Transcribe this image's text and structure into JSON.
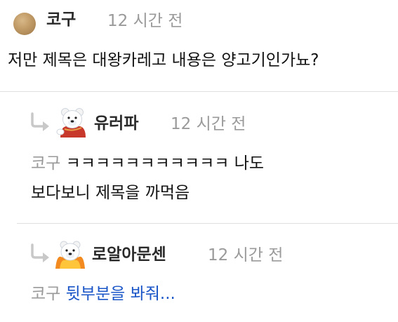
{
  "comment": {
    "author": "코구",
    "time": "12 시간 전",
    "text": "저만 제목은 대왕카레고 내용은 양고기인가뇨?"
  },
  "replies": [
    {
      "author": "유러파",
      "time": "12 시간 전",
      "mention": "코구",
      "line1": "ㅋㅋㅋㅋㅋㅋㅋㅋㅋㅋㅋ 나도",
      "line2": "보다보니 제목을 까먹음"
    },
    {
      "author": "로알아문센",
      "time": "12 시간 전",
      "mention": "코구",
      "link": "뒷부분을 봐줘..."
    }
  ],
  "icons": {
    "avatar": "avatar-circle",
    "reply": "reply-arrow-icon",
    "bear": "polar-bear-avatar"
  },
  "colors": {
    "author": "#2a2a2a",
    "time": "#9a9a9a",
    "mention": "#999999",
    "link": "#1a55c8",
    "divider": "#e0e0e0",
    "reply_arrow": "#c8c8c8"
  }
}
